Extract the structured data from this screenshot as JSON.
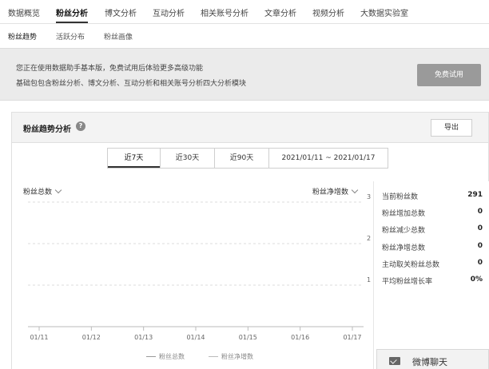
{
  "top_tabs": [
    "数据概览",
    "粉丝分析",
    "博文分析",
    "互动分析",
    "相关账号分析",
    "文章分析",
    "视频分析",
    "大数据实验室"
  ],
  "active_top_tab": "粉丝分析",
  "sub_tabs": [
    "粉丝趋势",
    "活跃分布",
    "粉丝画像"
  ],
  "banner": {
    "line1": "您正在使用数据助手基本版，免费试用后体验更多高级功能",
    "line2": "基础包包含粉丝分析、博文分析、互动分析和相关账号分析四大分析模块",
    "trial_button": "免费试用"
  },
  "panel": {
    "title": "粉丝趋势分析",
    "export_button": "导出",
    "ranges": [
      "近7天",
      "近30天",
      "近90天",
      "2021/01/11 ~ 2021/01/17"
    ],
    "active_range": "近7天",
    "left_metric": "粉丝总数",
    "right_metric": "粉丝净增数"
  },
  "stats": [
    {
      "label": "当前粉丝数",
      "value": "291"
    },
    {
      "label": "粉丝增加总数",
      "value": "0"
    },
    {
      "label": "粉丝减少总数",
      "value": "0"
    },
    {
      "label": "粉丝净增总数",
      "value": "0"
    },
    {
      "label": "主动取关粉丝总数",
      "value": "0"
    },
    {
      "label": "平均粉丝增长率",
      "value": "0%"
    }
  ],
  "chart_data": {
    "type": "line",
    "x": [
      "01/11",
      "01/12",
      "01/13",
      "01/14",
      "01/15",
      "01/16",
      "01/17"
    ],
    "y_right_ticks": [
      "3",
      "2",
      "1"
    ],
    "ylim": [
      0,
      3
    ],
    "series": [
      {
        "name": "粉丝总数",
        "values": []
      },
      {
        "name": "粉丝净增数",
        "values": []
      }
    ]
  },
  "chat": {
    "label": "微博聊天"
  },
  "colors": {
    "banner_bg": "#ebebeb",
    "button_gray": "#9a9a9a"
  }
}
